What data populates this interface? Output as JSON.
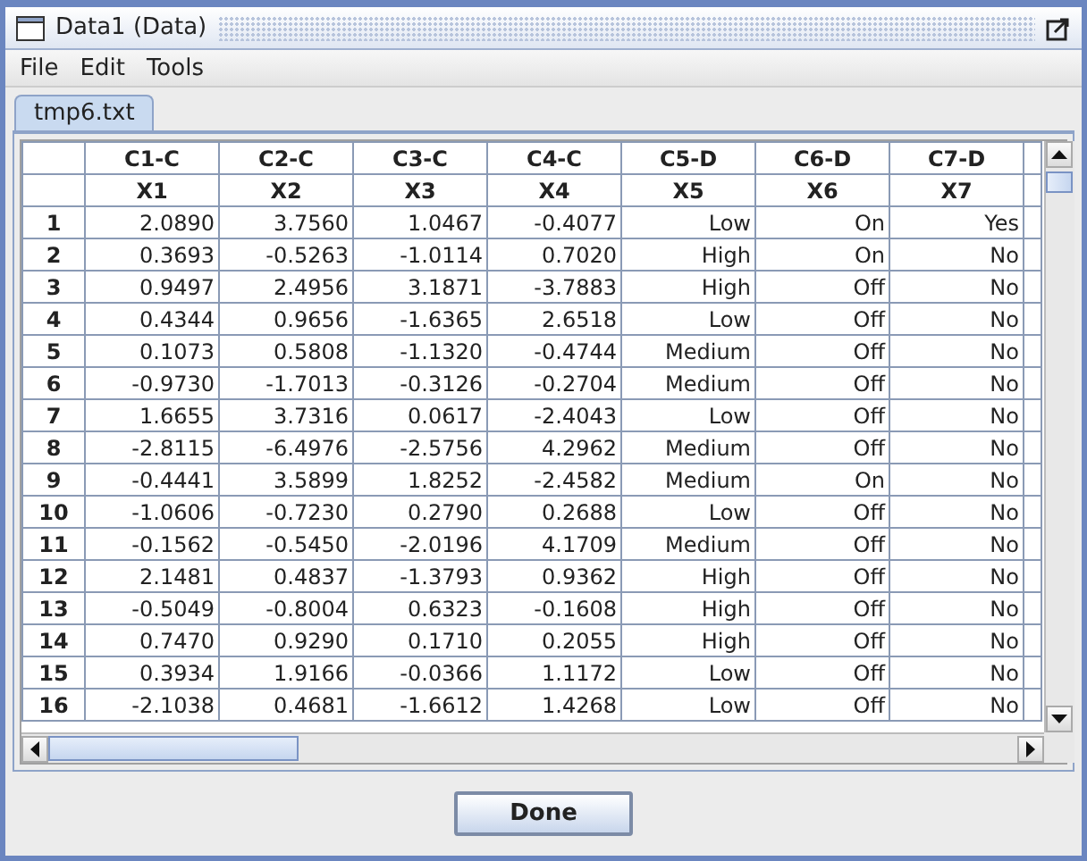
{
  "window": {
    "title": "Data1 (Data)"
  },
  "menu": [
    "File",
    "Edit",
    "Tools"
  ],
  "tabs": [
    {
      "label": "tmp6.txt",
      "selected": true
    }
  ],
  "table": {
    "columns": [
      {
        "code": "C1-C",
        "name": "X1"
      },
      {
        "code": "C2-C",
        "name": "X2"
      },
      {
        "code": "C3-C",
        "name": "X3"
      },
      {
        "code": "C4-C",
        "name": "X4"
      },
      {
        "code": "C5-D",
        "name": "X5"
      },
      {
        "code": "C6-D",
        "name": "X6"
      },
      {
        "code": "C7-D",
        "name": "X7"
      }
    ],
    "rows": [
      {
        "number": "1",
        "cells": [
          "2.0890",
          "3.7560",
          "1.0467",
          "-0.4077",
          "Low",
          "On",
          "Yes"
        ]
      },
      {
        "number": "2",
        "cells": [
          "0.3693",
          "-0.5263",
          "-1.0114",
          "0.7020",
          "High",
          "On",
          "No"
        ]
      },
      {
        "number": "3",
        "cells": [
          "0.9497",
          "2.4956",
          "3.1871",
          "-3.7883",
          "High",
          "Off",
          "No"
        ]
      },
      {
        "number": "4",
        "cells": [
          "0.4344",
          "0.9656",
          "-1.6365",
          "2.6518",
          "Low",
          "Off",
          "No"
        ]
      },
      {
        "number": "5",
        "cells": [
          "0.1073",
          "0.5808",
          "-1.1320",
          "-0.4744",
          "Medium",
          "Off",
          "No"
        ]
      },
      {
        "number": "6",
        "cells": [
          "-0.9730",
          "-1.7013",
          "-0.3126",
          "-0.2704",
          "Medium",
          "Off",
          "No"
        ]
      },
      {
        "number": "7",
        "cells": [
          "1.6655",
          "3.7316",
          "0.0617",
          "-2.4043",
          "Low",
          "Off",
          "No"
        ]
      },
      {
        "number": "8",
        "cells": [
          "-2.8115",
          "-6.4976",
          "-2.5756",
          "4.2962",
          "Medium",
          "Off",
          "No"
        ]
      },
      {
        "number": "9",
        "cells": [
          "-0.4441",
          "3.5899",
          "1.8252",
          "-2.4582",
          "Medium",
          "On",
          "No"
        ]
      },
      {
        "number": "10",
        "cells": [
          "-1.0606",
          "-0.7230",
          "0.2790",
          "0.2688",
          "Low",
          "Off",
          "No"
        ]
      },
      {
        "number": "11",
        "cells": [
          "-0.1562",
          "-0.5450",
          "-2.0196",
          "4.1709",
          "Medium",
          "Off",
          "No"
        ]
      },
      {
        "number": "12",
        "cells": [
          "2.1481",
          "0.4837",
          "-1.3793",
          "0.9362",
          "High",
          "Off",
          "No"
        ]
      },
      {
        "number": "13",
        "cells": [
          "-0.5049",
          "-0.8004",
          "0.6323",
          "-0.1608",
          "High",
          "Off",
          "No"
        ]
      },
      {
        "number": "14",
        "cells": [
          "0.7470",
          "0.9290",
          "0.1710",
          "0.2055",
          "High",
          "Off",
          "No"
        ]
      },
      {
        "number": "15",
        "cells": [
          "0.3934",
          "1.9166",
          "-0.0366",
          "1.1172",
          "Low",
          "Off",
          "No"
        ]
      },
      {
        "number": "16",
        "cells": [
          "-2.1038",
          "0.4681",
          "-1.6612",
          "1.4268",
          "Low",
          "Off",
          "No"
        ]
      }
    ]
  },
  "buttons": [
    "Done"
  ]
}
